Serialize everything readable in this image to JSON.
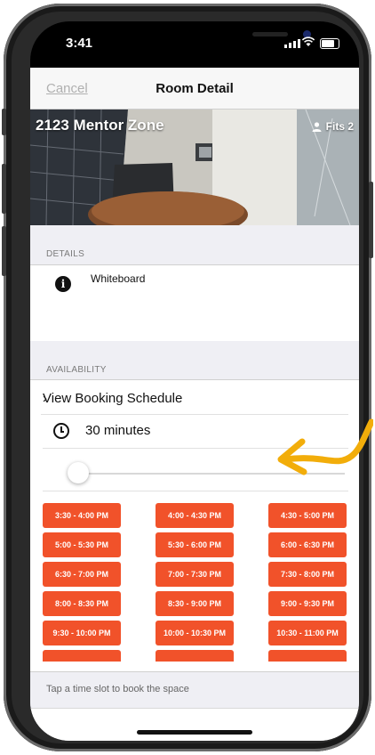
{
  "status_bar": {
    "time": "3:41"
  },
  "navbar": {
    "cancel_label": "Cancel",
    "title": "Room Detail"
  },
  "room": {
    "name": "2123 Mentor Zone",
    "capacity_label": "Fits 2"
  },
  "details": {
    "header": "DETAILS",
    "amenities": [
      "Whiteboard"
    ]
  },
  "availability": {
    "header": "AVAILABILITY",
    "view_schedule_label": "View Booking Schedule",
    "duration_label": "30 minutes",
    "slider_value_fraction": 0.0
  },
  "time_slots": [
    "3:30 - 4:00 PM",
    "4:00 - 4:30 PM",
    "4:30 - 5:00 PM",
    "5:00 - 5:30 PM",
    "5:30 - 6:00 PM",
    "6:00 - 6:30 PM",
    "6:30 - 7:00 PM",
    "7:00 - 7:30 PM",
    "7:30 - 8:00 PM",
    "8:00 - 8:30 PM",
    "8:30 - 9:00 PM",
    "9:00 - 9:30 PM",
    "9:30 - 10:00 PM",
    "10:00 - 10:30 PM",
    "10:30 - 11:00 PM",
    "",
    "",
    ""
  ],
  "footer": {
    "hint": "Tap a time slot to book the space"
  },
  "colors": {
    "slot": "#f1522a",
    "annotation_arrow": "#f2ad0a"
  }
}
